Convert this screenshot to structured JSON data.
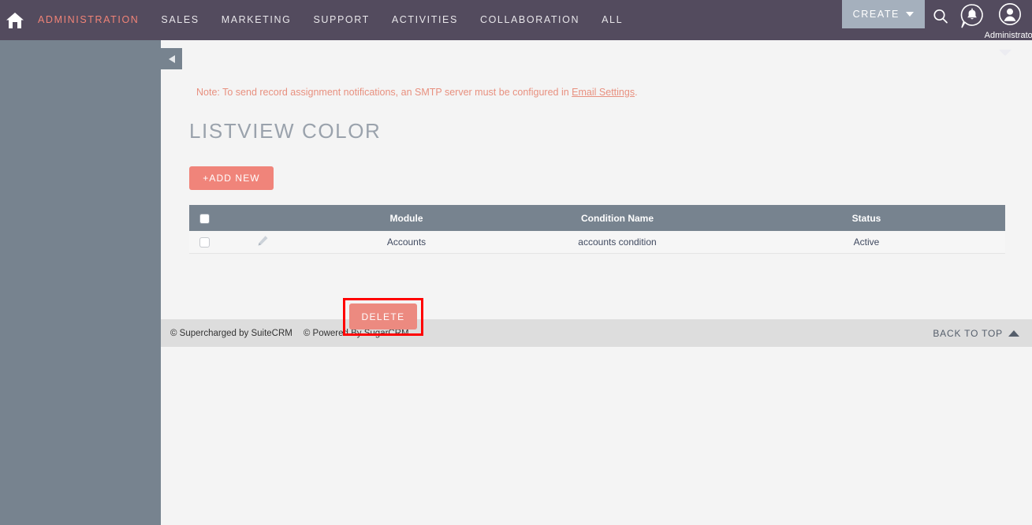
{
  "navbar": {
    "home_icon": "home-icon",
    "links": [
      {
        "label": "ADMINISTRATION",
        "active": true
      },
      {
        "label": "SALES",
        "active": false
      },
      {
        "label": "MARKETING",
        "active": false
      },
      {
        "label": "SUPPORT",
        "active": false
      },
      {
        "label": "ACTIVITIES",
        "active": false
      },
      {
        "label": "COLLABORATION",
        "active": false
      },
      {
        "label": "ALL",
        "active": false
      }
    ],
    "create_label": "CREATE",
    "search_icon": "search-icon",
    "notification_icon": "notification-bell-icon",
    "user_icon": "user-avatar-icon",
    "user_name": "Administrator"
  },
  "sidebar": {
    "collapse_icon": "collapse-left-icon"
  },
  "content": {
    "note_prefix": "Note: To send record assignment notifications, an SMTP server must be configured in ",
    "note_link": "Email Settings",
    "note_suffix": ".",
    "page_title": "LISTVIEW COLOR",
    "add_new_label": "+ADD NEW",
    "delete_label": "DELETE"
  },
  "table": {
    "columns": [
      "",
      "",
      "Module",
      "Condition Name",
      "Status"
    ],
    "rows": [
      {
        "module": "Accounts",
        "condition_name": "accounts condition",
        "status": "Active"
      }
    ]
  },
  "footer": {
    "supercharged": "© Supercharged by SuiteCRM",
    "powered": "© Powered By SugarCRM",
    "back_to_top": "BACK TO TOP"
  },
  "colors": {
    "navbar_bg": "#534b5e",
    "accent_salmon": "#f0847a",
    "sidebar_bg": "#77838f",
    "highlight_red": "#ff0000"
  }
}
